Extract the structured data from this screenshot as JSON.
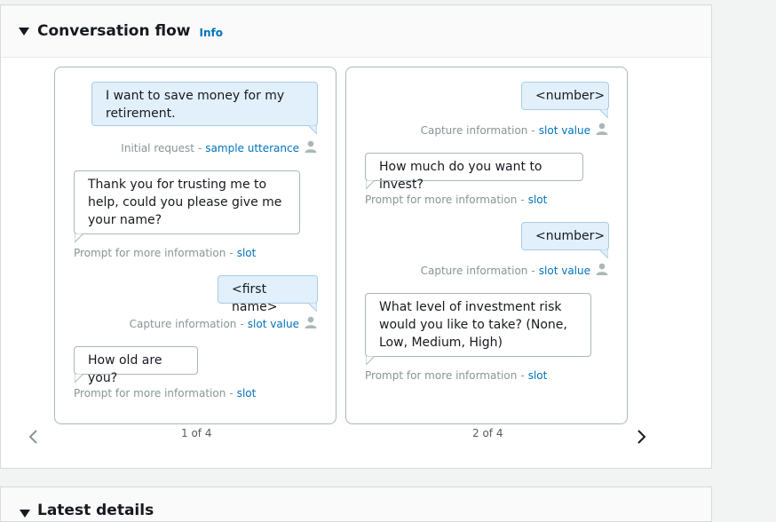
{
  "section": {
    "title": "Conversation flow",
    "info_link": "Info"
  },
  "cards": [
    {
      "page_label": "1 of 4",
      "messages": [
        {
          "role": "user",
          "text": "I want to save money for my retirement.",
          "caption_prefix": "Initial request",
          "caption_link": "sample utterance"
        },
        {
          "role": "bot",
          "text": "Thank you for trusting me to help, could you please give me your name?",
          "caption_prefix": "Prompt for more information",
          "caption_link": "slot"
        },
        {
          "role": "user",
          "text": "<first name>",
          "caption_prefix": "Capture information",
          "caption_link": "slot value"
        },
        {
          "role": "bot",
          "text": "How old are you?",
          "caption_prefix": "Prompt for more information",
          "caption_link": "slot"
        }
      ]
    },
    {
      "page_label": "2 of 4",
      "messages": [
        {
          "role": "user",
          "text": "<number>",
          "caption_prefix": "Capture information",
          "caption_link": "slot value"
        },
        {
          "role": "bot",
          "text": "How much do you want to invest?",
          "caption_prefix": "Prompt for more information",
          "caption_link": "slot"
        },
        {
          "role": "user",
          "text": "<number>",
          "caption_prefix": "Capture information",
          "caption_link": "slot value"
        },
        {
          "role": "bot",
          "text": "What level of investment risk would you like to take? (None, Low, Medium, High)",
          "caption_prefix": "Prompt for more information",
          "caption_link": "slot"
        }
      ]
    }
  ],
  "separator": "-",
  "next_section": {
    "title": "Latest details"
  },
  "icons": {
    "caret": "caret-down-icon",
    "prev": "chevron-left-icon",
    "next": "chevron-right-icon",
    "person": "user-icon"
  },
  "colors": {
    "link": "#0073bb",
    "user_bubble": "#e1f0fb",
    "muted": "#879596"
  }
}
